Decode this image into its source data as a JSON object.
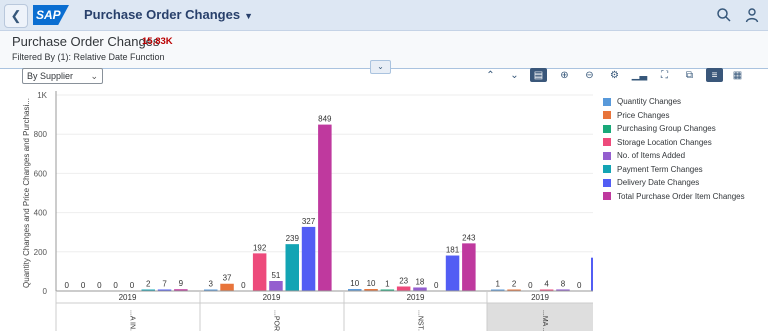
{
  "shellbar": {
    "logo_text": "SAP",
    "title": "Purchase Order Changes"
  },
  "header": {
    "title": "Purchase Order Changes",
    "count": "15,83K",
    "filter": "Filtered By (1): Relative Date Function"
  },
  "controls": {
    "group_by": "By Supplier"
  },
  "toolbar": [
    "expand-all",
    "collapse-all",
    "table-view",
    "zoom-in",
    "zoom-out",
    "settings",
    "chart-type",
    "fullscreen",
    "copy",
    "bar-chart-view",
    "grid-view"
  ],
  "legend": [
    {
      "label": "Quantity Changes",
      "color": "#5899da"
    },
    {
      "label": "Price Changes",
      "color": "#e8743b"
    },
    {
      "label": "Purchasing Group Changes",
      "color": "#19a979"
    },
    {
      "label": "Storage Location Changes",
      "color": "#ed4a7b"
    },
    {
      "label": "No. of Items Added",
      "color": "#945ecf"
    },
    {
      "label": "Payment Term Changes",
      "color": "#13a4b4"
    },
    {
      "label": "Delivery Date Changes",
      "color": "#525df4"
    },
    {
      "label": "Total Purchase Order Item Changes",
      "color": "#bf399e"
    }
  ],
  "chart_data": {
    "type": "bar",
    "ylabel": "Quantity Changes and Price Changes and Purchasi...",
    "ylim": [
      0,
      1000
    ],
    "yticks": [
      "0",
      "200",
      "400",
      "600",
      "800",
      "1K"
    ],
    "groups": [
      {
        "year": "2019",
        "supplier": "...A IN...",
        "values": [
          0,
          0,
          0,
          0,
          0,
          2,
          7,
          9
        ]
      },
      {
        "year": "2019",
        "supplier": "...POR...",
        "values": [
          3,
          37,
          0,
          192,
          51,
          239,
          327,
          849
        ]
      },
      {
        "year": "2019",
        "supplier": "...NST...",
        "values": [
          10,
          10,
          1,
          23,
          18,
          0,
          181,
          243
        ]
      },
      {
        "year": "2019",
        "supplier": "...MA ...",
        "values": [
          1,
          2,
          0,
          4,
          8,
          0,
          null,
          null
        ]
      }
    ]
  }
}
